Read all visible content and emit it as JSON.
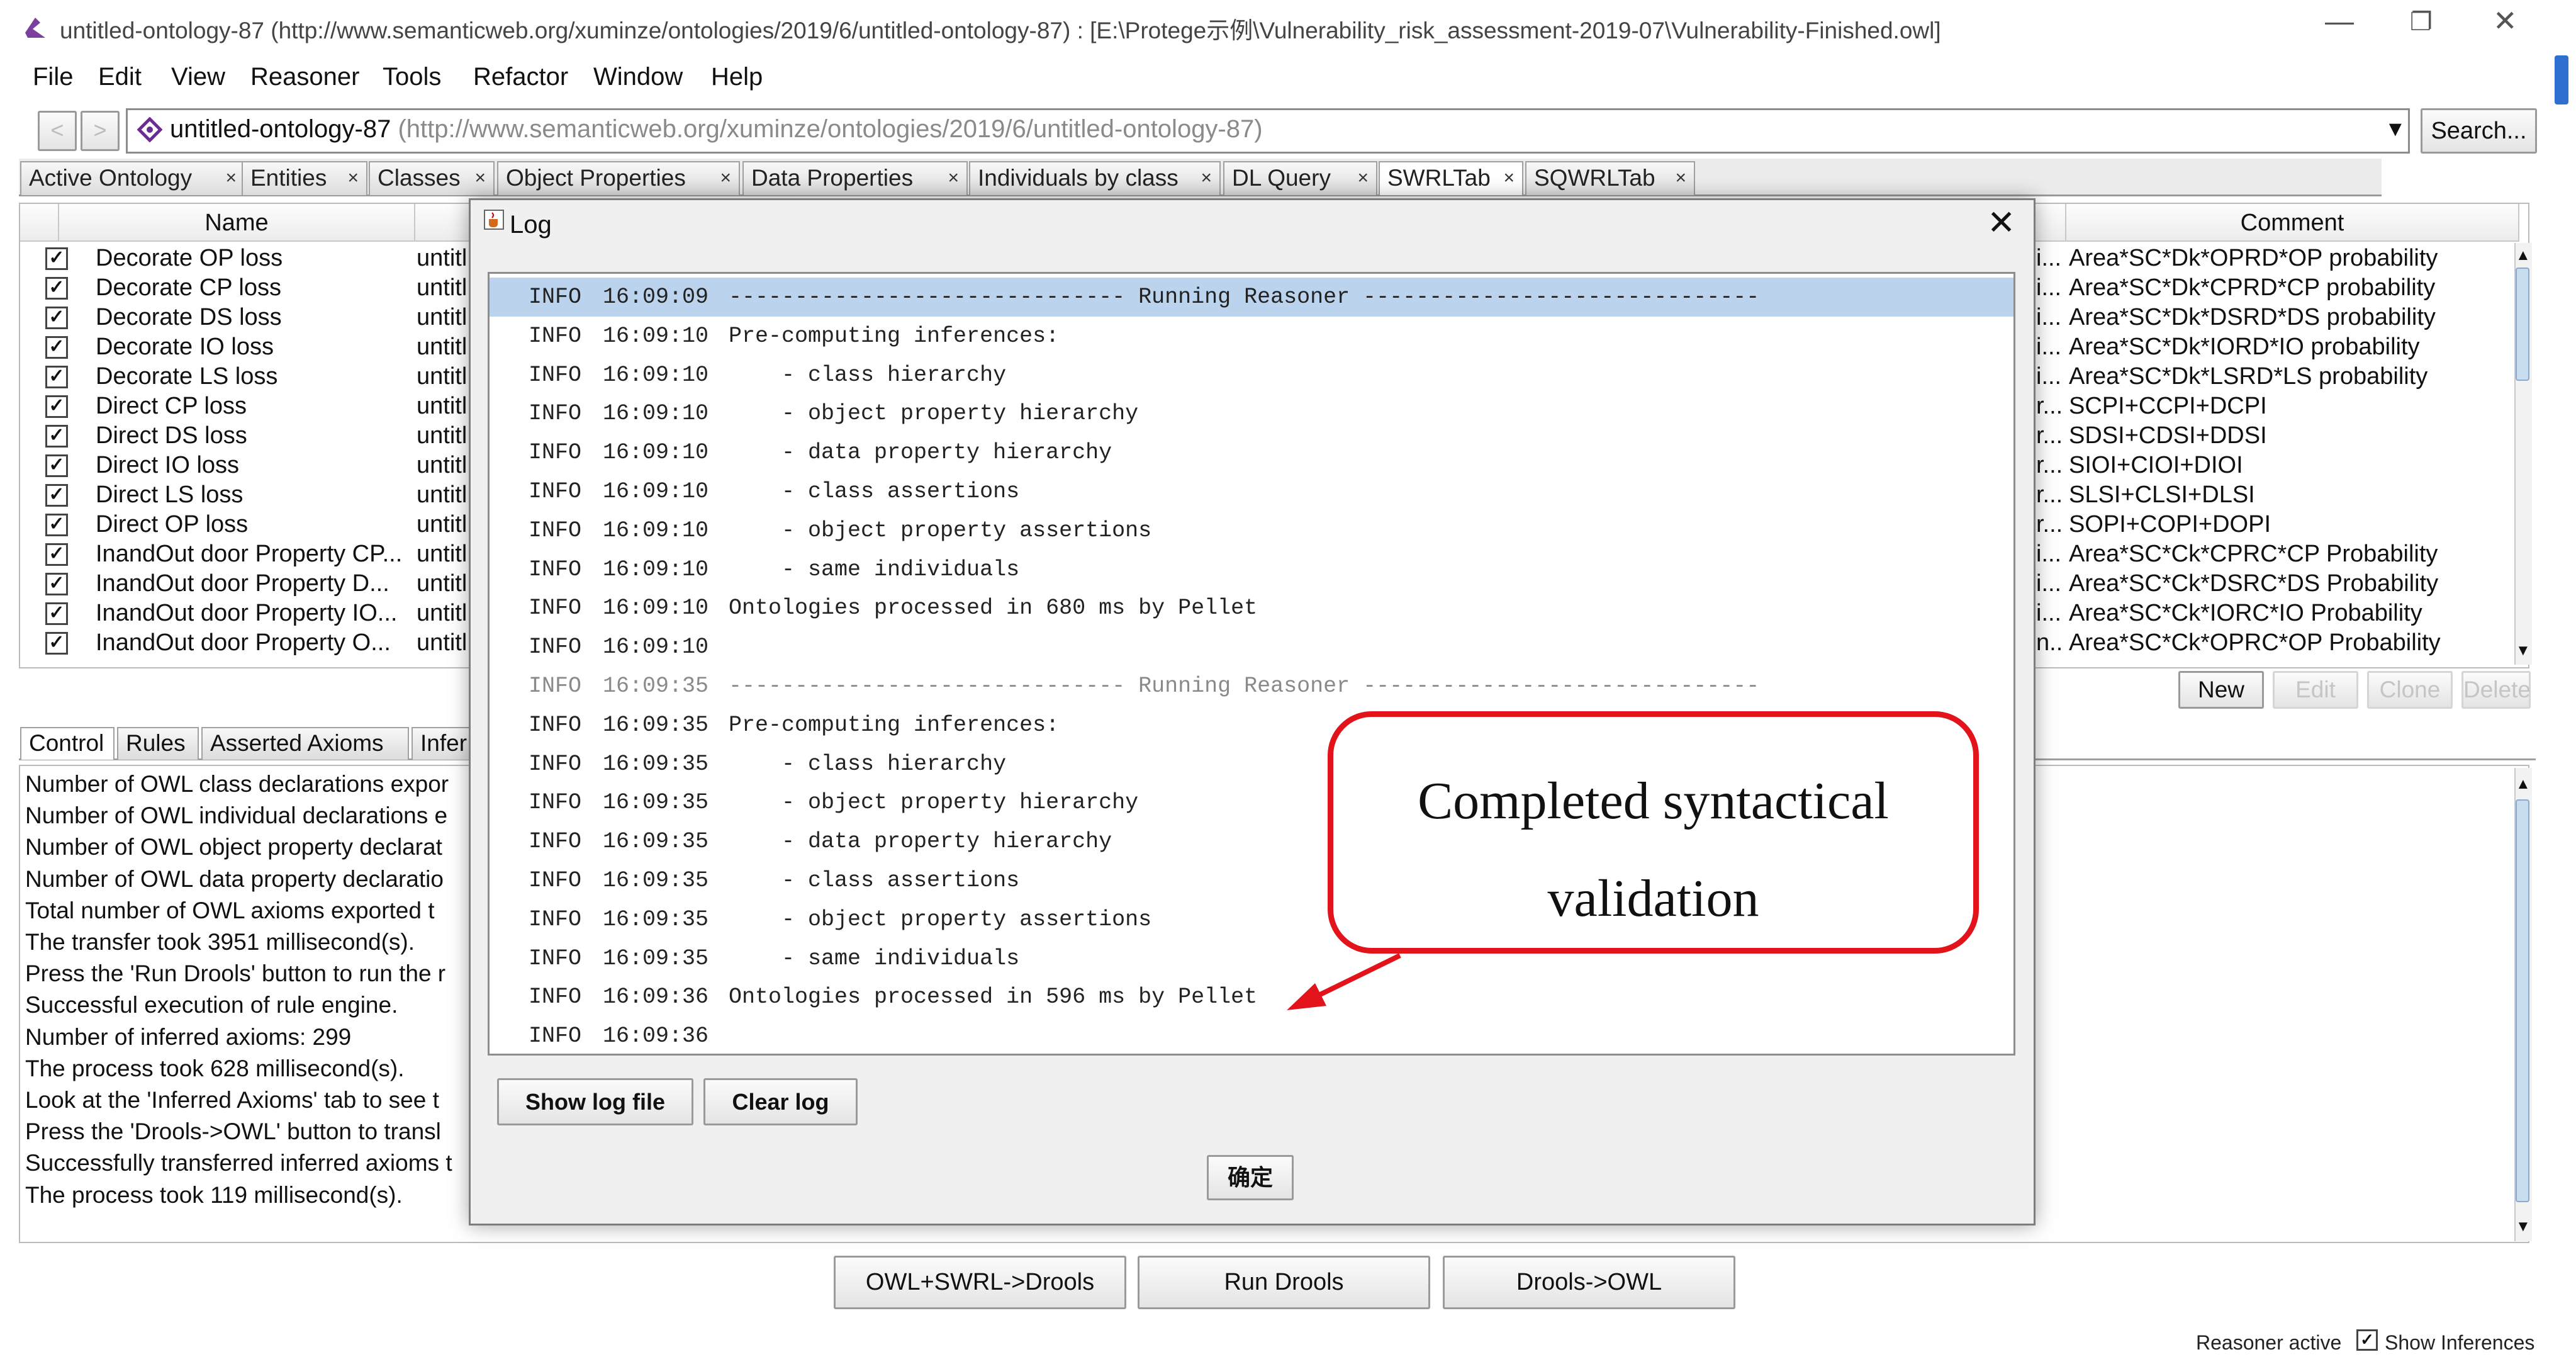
{
  "window": {
    "title": "untitled-ontology-87 (http://www.semanticweb.org/xuminze/ontologies/2019/6/untitled-ontology-87)  : [E:\\Protege示例\\Vulnerability_risk_assessment-2019-07\\Vulnerability-Finished.owl]",
    "app_icon": "protege-icon",
    "controls": {
      "minimize": "—",
      "restore": "❐",
      "close": "✕"
    }
  },
  "menu": [
    "File",
    "Edit",
    "View",
    "Reasoner",
    "Tools",
    "Refactor",
    "Window",
    "Help"
  ],
  "address": {
    "back": "<",
    "forward": ">",
    "ontology_name": "untitled-ontology-87",
    "ontology_iri": "(http://www.semanticweb.org/xuminze/ontologies/2019/6/untitled-ontology-87)",
    "dropdown": "▼",
    "search_label": "Search..."
  },
  "tabs": [
    "Active Ontology",
    "Entities",
    "Classes",
    "Object Properties",
    "Data Properties",
    "Individuals by class",
    "DL Query",
    "SWRLTab",
    "SQWRLTab"
  ],
  "tab_close": "×",
  "rules_table": {
    "headers": {
      "name": "Name",
      "comment": "Comment"
    },
    "rows": [
      {
        "checked": "✓",
        "name": "Decorate  OP loss",
        "ont": "untitl",
        "trunc": "i...",
        "comment": "Area*SC*Dk*OPRD*OP probability"
      },
      {
        "checked": "✓",
        "name": "Decorate CP loss",
        "ont": "untitl",
        "trunc": "i...",
        "comment": "Area*SC*Dk*CPRD*CP probability"
      },
      {
        "checked": "✓",
        "name": "Decorate DS loss",
        "ont": "untitl",
        "trunc": "i...",
        "comment": "Area*SC*Dk*DSRD*DS probability"
      },
      {
        "checked": "✓",
        "name": "Decorate IO loss",
        "ont": "untitl",
        "trunc": "i...",
        "comment": "Area*SC*Dk*IORD*IO probability"
      },
      {
        "checked": "✓",
        "name": "Decorate LS loss",
        "ont": "untitl",
        "trunc": "i...",
        "comment": "Area*SC*Dk*LSRD*LS probability"
      },
      {
        "checked": "✓",
        "name": "Direct CP loss",
        "ont": "untitl",
        "trunc": "r...",
        "comment": "SCPI+CCPI+DCPI"
      },
      {
        "checked": "✓",
        "name": "Direct DS loss",
        "ont": "untitl",
        "trunc": "r...",
        "comment": "SDSI+CDSI+DDSI"
      },
      {
        "checked": "✓",
        "name": "Direct IO loss",
        "ont": "untitl",
        "trunc": "r...",
        "comment": "SIOI+CIOI+DIOI"
      },
      {
        "checked": "✓",
        "name": "Direct LS loss",
        "ont": "untitl",
        "trunc": "r...",
        "comment": "SLSI+CLSI+DLSI"
      },
      {
        "checked": "✓",
        "name": "Direct OP loss",
        "ont": "untitl",
        "trunc": "r...",
        "comment": "SOPI+COPI+DOPI"
      },
      {
        "checked": "✓",
        "name": "InandOut door Property CP...",
        "ont": "untitl",
        "trunc": "i...",
        "comment": "Area*SC*Ck*CPRC*CP Probability"
      },
      {
        "checked": "✓",
        "name": "InandOut door Property D...",
        "ont": "untitl",
        "trunc": "i...",
        "comment": "Area*SC*Ck*DSRC*DS Probability"
      },
      {
        "checked": "✓",
        "name": "InandOut door Property IO...",
        "ont": "untitl",
        "trunc": "i...",
        "comment": "Area*SC*Ck*IORC*IO Probability"
      },
      {
        "checked": "✓",
        "name": "InandOut door Property O...",
        "ont": "untitl",
        "trunc": "n...",
        "comment": "Area*SC*Ck*OPRC*OP Probability"
      }
    ],
    "buttons": {
      "new": "New",
      "edit": "Edit",
      "clone": "Clone",
      "delete": "Delete"
    }
  },
  "lower_tabs": [
    "Control",
    "Rules",
    "Asserted Axioms",
    "Infer"
  ],
  "console": [
    "Number of OWL class declarations expor",
    "Number of OWL individual declarations e",
    "Number of OWL object property declarat",
    "Number of OWL data property declaratio",
    "Total number of OWL axioms exported t",
    "The transfer took 3951 millisecond(s).",
    "Press the 'Run Drools' button to run the r",
    "Successful execution of rule engine.",
    "Number of inferred axioms: 299",
    "The process took 628 millisecond(s).",
    "Look at the 'Inferred Axioms' tab to see t",
    "Press the 'Drools->OWL' button to transl",
    "Successfully transferred inferred axioms t",
    "The process took 119 millisecond(s)."
  ],
  "bottom_buttons": [
    "OWL+SWRL->Drools",
    "Run Drools",
    "Drools->OWL"
  ],
  "status": {
    "reasoner": "Reasoner active",
    "show_inferences": "Show Inferences",
    "check": "✓"
  },
  "scroll": {
    "up": "▲",
    "down": "▼"
  },
  "log_dialog": {
    "title": "Log",
    "close": "✕",
    "lines": [
      {
        "level": "INFO",
        "time": "16:09:09",
        "msg": "------------------------------ Running Reasoner ------------------------------"
      },
      {
        "level": "INFO",
        "time": "16:09:10",
        "msg": "Pre-computing inferences:"
      },
      {
        "level": "INFO",
        "time": "16:09:10",
        "msg": "    - class hierarchy"
      },
      {
        "level": "INFO",
        "time": "16:09:10",
        "msg": "    - object property hierarchy"
      },
      {
        "level": "INFO",
        "time": "16:09:10",
        "msg": "    - data property hierarchy"
      },
      {
        "level": "INFO",
        "time": "16:09:10",
        "msg": "    - class assertions"
      },
      {
        "level": "INFO",
        "time": "16:09:10",
        "msg": "    - object property assertions"
      },
      {
        "level": "INFO",
        "time": "16:09:10",
        "msg": "    - same individuals"
      },
      {
        "level": "INFO",
        "time": "16:09:10",
        "msg": "Ontologies processed in 680 ms by Pellet"
      },
      {
        "level": "INFO",
        "time": "16:09:10",
        "msg": ""
      },
      {
        "level": "INFO",
        "time": "16:09:35",
        "msg": "------------------------------ Running Reasoner ------------------------------"
      },
      {
        "level": "INFO",
        "time": "16:09:35",
        "msg": "Pre-computing inferences:"
      },
      {
        "level": "INFO",
        "time": "16:09:35",
        "msg": "    - class hierarchy"
      },
      {
        "level": "INFO",
        "time": "16:09:35",
        "msg": "    - object property hierarchy"
      },
      {
        "level": "INFO",
        "time": "16:09:35",
        "msg": "    - data property hierarchy"
      },
      {
        "level": "INFO",
        "time": "16:09:35",
        "msg": "    - class assertions"
      },
      {
        "level": "INFO",
        "time": "16:09:35",
        "msg": "    - object property assertions"
      },
      {
        "level": "INFO",
        "time": "16:09:35",
        "msg": "    - same individuals"
      },
      {
        "level": "INFO",
        "time": "16:09:36",
        "msg": "Ontologies processed in 596 ms by Pellet"
      },
      {
        "level": "INFO",
        "time": "16:09:36",
        "msg": ""
      }
    ],
    "show_log_label": "Show log file",
    "clear_log_label": "Clear log",
    "ok_label": "确定"
  },
  "callout": {
    "line1": "Completed syntactical",
    "line2": "validation",
    "color": "#e3131b"
  }
}
